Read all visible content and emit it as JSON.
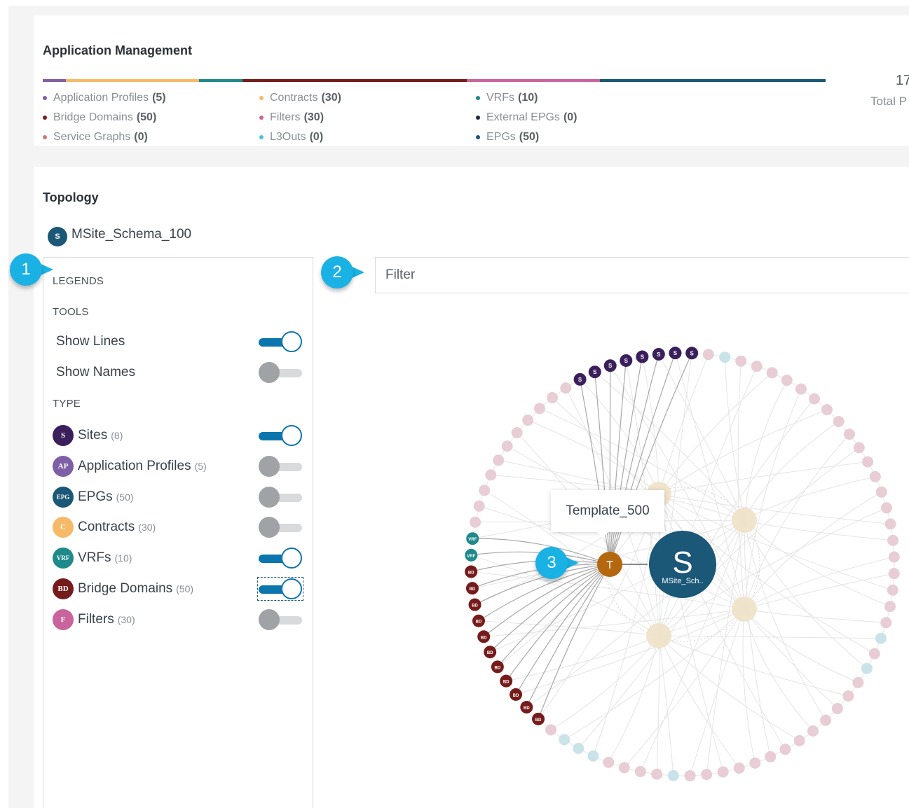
{
  "app_management": {
    "title": "Application Management",
    "progress_colors": [
      "#7e5fa6",
      "#f5b968",
      "#1f8a8a",
      "#761b1b",
      "#c9649c",
      "#1b5776"
    ],
    "legend": [
      {
        "label": "Application Profiles",
        "count": "(5)",
        "color": "#7e5fa6"
      },
      {
        "label": "Bridge Domains",
        "count": "(50)",
        "color": "#761b1b"
      },
      {
        "label": "Service Graphs",
        "count": "(0)",
        "color": "#c97b7b"
      },
      {
        "label": "Contracts",
        "count": "(30)",
        "color": "#f5b968"
      },
      {
        "label": "Filters",
        "count": "(30)",
        "color": "#c9649c"
      },
      {
        "label": "L3Outs",
        "count": "(0)",
        "color": "#4cc4d6"
      },
      {
        "label": "VRFs",
        "count": "(10)",
        "color": "#1f8a8a"
      },
      {
        "label": "External EPGs",
        "count": "(0)",
        "color": "#1e2b3a"
      },
      {
        "label": "EPGs",
        "count": "(50)",
        "color": "#1b5776"
      }
    ],
    "total_value": "17",
    "total_label": "Total P"
  },
  "topology": {
    "title": "Topology",
    "schema_badge": "S",
    "schema_name": "MSite_Schema_100",
    "legends_heading": "LEGENDS",
    "tools_heading": "TOOLS",
    "tools": [
      {
        "label": "Show Lines",
        "on": true
      },
      {
        "label": "Show Names",
        "on": false
      }
    ],
    "type_heading": "TYPE",
    "types": [
      {
        "badge": "S",
        "label": "Sites",
        "count": "(8)",
        "color": "#3a1f5c",
        "on": true
      },
      {
        "badge": "AP",
        "label": "Application Profiles",
        "count": "(5)",
        "color": "#7e5fa6",
        "on": false
      },
      {
        "badge": "EPG",
        "label": "EPGs",
        "count": "(50)",
        "color": "#1b5776",
        "on": false
      },
      {
        "badge": "C",
        "label": "Contracts",
        "count": "(30)",
        "color": "#f5b968",
        "on": false
      },
      {
        "badge": "VRF",
        "label": "VRFs",
        "count": "(10)",
        "color": "#1f8a8a",
        "on": true
      },
      {
        "badge": "BD",
        "label": "Bridge Domains",
        "count": "(50)",
        "color": "#761b1b",
        "on": true,
        "focus": true
      },
      {
        "badge": "F",
        "label": "Filters",
        "count": "(30)",
        "color": "#c9649c",
        "on": false
      }
    ],
    "filter_placeholder": "Filter",
    "callouts": [
      "1",
      "2",
      "3"
    ],
    "tooltip": "Template_500",
    "template_node": {
      "badge": "T",
      "color": "#b5670f"
    },
    "schema_node": {
      "letter": "S",
      "label": "MSite_Sch..",
      "color": "#1b5776"
    },
    "site_badge": "S",
    "bd_badge": "BD",
    "vrf_badge": "VRF",
    "ring_colors": {
      "site": "#3a1f5c",
      "bd": "#761b1b",
      "vrf": "#1f8a8a",
      "faded_pink": "#e8cdd4",
      "faded_blue": "#c9e3e8",
      "inner": "#f0e1c8"
    }
  }
}
